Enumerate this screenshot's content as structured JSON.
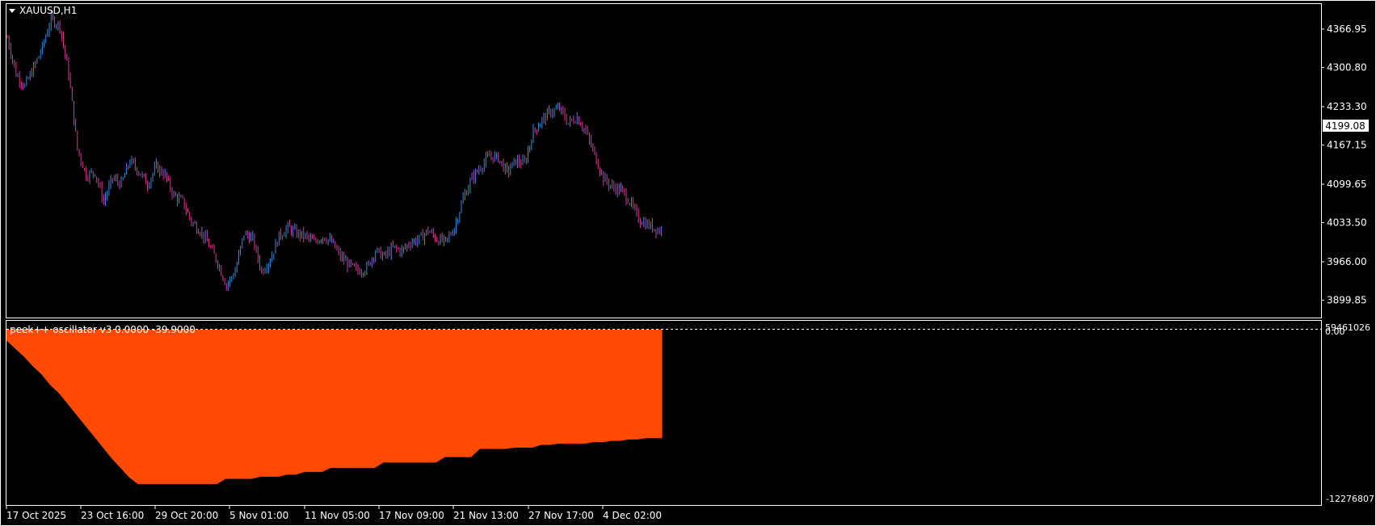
{
  "window": {
    "symbol_label": "XAUUSD,H1",
    "current_price_label": "4199.08"
  },
  "colors": {
    "background": "#000000",
    "grid_border": "#ffffff",
    "candle_bull": "#3e8ad6",
    "candle_bear": "#d23c96",
    "oscillator_fill": "#ff4a06",
    "price_tag_bg": "#ffffff",
    "price_tag_fg": "#000000"
  },
  "indicator": {
    "label": "peek++ oscillator v3 0.0000 -39.9000",
    "scale_top_label": "0.00",
    "scale_overlap_label": "59461026",
    "scale_bottom_label": "-12276807"
  },
  "chart_data": [
    {
      "type": "candlestick",
      "title": "XAUUSD,H1",
      "ylim": [
        3870,
        4410
      ],
      "y_ticks": [
        4366.95,
        4300.8,
        4233.3,
        4167.15,
        4099.65,
        4033.5,
        3966.0,
        3899.85
      ],
      "x_tick_labels": [
        "17 Oct 2025",
        "23 Oct 16:00",
        "29 Oct 20:00",
        "5 Nov 01:00",
        "11 Nov 05:00",
        "17 Nov 09:00",
        "21 Nov 13:00",
        "27 Nov 17:00",
        "4 Dec 02:00"
      ],
      "bar_count": 374,
      "close_path": [
        [
          0,
          4352
        ],
        [
          5,
          4290
        ],
        [
          10,
          4268
        ],
        [
          15,
          4300
        ],
        [
          20,
          4335
        ],
        [
          25,
          4385
        ],
        [
          30,
          4372
        ],
        [
          35,
          4290
        ],
        [
          40,
          4160
        ],
        [
          45,
          4115
        ],
        [
          50,
          4120
        ],
        [
          55,
          4070
        ],
        [
          60,
          4110
        ],
        [
          65,
          4100
        ],
        [
          70,
          4140
        ],
        [
          75,
          4122
        ],
        [
          80,
          4100
        ],
        [
          85,
          4130
        ],
        [
          90,
          4115
        ],
        [
          95,
          4080
        ],
        [
          100,
          4070
        ],
        [
          105,
          4035
        ],
        [
          110,
          4020
        ],
        [
          115,
          3995
        ],
        [
          120,
          3965
        ],
        [
          125,
          3925
        ],
        [
          130,
          3950
        ],
        [
          135,
          4015
        ],
        [
          140,
          4005
        ],
        [
          145,
          3950
        ],
        [
          150,
          3970
        ],
        [
          155,
          4010
        ],
        [
          160,
          4025
        ],
        [
          165,
          4015
        ],
        [
          170,
          4010
        ],
        [
          175,
          4000
        ],
        [
          180,
          4010
        ],
        [
          185,
          4000
        ],
        [
          190,
          3975
        ],
        [
          195,
          3960
        ],
        [
          200,
          3950
        ],
        [
          205,
          3955
        ],
        [
          210,
          3985
        ],
        [
          215,
          3975
        ],
        [
          220,
          3990
        ],
        [
          225,
          3985
        ],
        [
          230,
          4000
        ],
        [
          235,
          4005
        ],
        [
          240,
          4020
        ],
        [
          245,
          4005
        ],
        [
          250,
          4000
        ],
        [
          255,
          4025
        ],
        [
          260,
          4075
        ],
        [
          265,
          4110
        ],
        [
          270,
          4130
        ],
        [
          275,
          4148
        ],
        [
          280,
          4145
        ],
        [
          285,
          4120
        ],
        [
          290,
          4140
        ],
        [
          295,
          4135
        ],
        [
          300,
          4190
        ],
        [
          305,
          4210
        ],
        [
          310,
          4225
        ],
        [
          315,
          4230
        ],
        [
          320,
          4205
        ],
        [
          325,
          4215
        ],
        [
          330,
          4190
        ],
        [
          335,
          4150
        ],
        [
          340,
          4110
        ],
        [
          345,
          4095
        ],
        [
          350,
          4090
        ],
        [
          355,
          4070
        ],
        [
          360,
          4040
        ],
        [
          365,
          4030
        ],
        [
          372,
          4020
        ]
      ]
    },
    {
      "type": "area",
      "title": "peek++ oscillator v3 0.0000 -39.9000",
      "ylim": [
        -12276807,
        0
      ],
      "x_bar_end": 374,
      "lower_envelope": [
        [
          0,
          -800000
        ],
        [
          5,
          -1400000
        ],
        [
          10,
          -2000000
        ],
        [
          15,
          -2700000
        ],
        [
          20,
          -3300000
        ],
        [
          25,
          -4100000
        ],
        [
          30,
          -4700000
        ],
        [
          35,
          -5500000
        ],
        [
          40,
          -6300000
        ],
        [
          45,
          -7100000
        ],
        [
          50,
          -7900000
        ],
        [
          55,
          -8700000
        ],
        [
          60,
          -9500000
        ],
        [
          65,
          -10200000
        ],
        [
          70,
          -10900000
        ],
        [
          75,
          -11400000
        ],
        [
          80,
          -11400000
        ],
        [
          85,
          -11400000
        ],
        [
          90,
          -11400000
        ],
        [
          95,
          -11400000
        ],
        [
          100,
          -11400000
        ],
        [
          105,
          -11400000
        ],
        [
          110,
          -11400000
        ],
        [
          115,
          -11400000
        ],
        [
          120,
          -11400000
        ],
        [
          125,
          -11000000
        ],
        [
          130,
          -11000000
        ],
        [
          135,
          -11000000
        ],
        [
          140,
          -11000000
        ],
        [
          145,
          -10850000
        ],
        [
          150,
          -10850000
        ],
        [
          155,
          -10850000
        ],
        [
          160,
          -10700000
        ],
        [
          165,
          -10700000
        ],
        [
          170,
          -10500000
        ],
        [
          175,
          -10500000
        ],
        [
          180,
          -10500000
        ],
        [
          185,
          -10200000
        ],
        [
          190,
          -10200000
        ],
        [
          195,
          -10200000
        ],
        [
          200,
          -10200000
        ],
        [
          205,
          -10200000
        ],
        [
          210,
          -10200000
        ],
        [
          215,
          -9800000
        ],
        [
          220,
          -9800000
        ],
        [
          225,
          -9800000
        ],
        [
          230,
          -9800000
        ],
        [
          235,
          -9800000
        ],
        [
          240,
          -9800000
        ],
        [
          245,
          -9800000
        ],
        [
          250,
          -9400000
        ],
        [
          255,
          -9400000
        ],
        [
          260,
          -9400000
        ],
        [
          265,
          -9400000
        ],
        [
          270,
          -8800000
        ],
        [
          275,
          -8800000
        ],
        [
          280,
          -8800000
        ],
        [
          285,
          -8800000
        ],
        [
          290,
          -8700000
        ],
        [
          295,
          -8700000
        ],
        [
          300,
          -8700000
        ],
        [
          305,
          -8500000
        ],
        [
          310,
          -8500000
        ],
        [
          315,
          -8400000
        ],
        [
          320,
          -8400000
        ],
        [
          325,
          -8400000
        ],
        [
          330,
          -8400000
        ],
        [
          335,
          -8300000
        ],
        [
          340,
          -8300000
        ],
        [
          345,
          -8200000
        ],
        [
          350,
          -8200000
        ],
        [
          355,
          -8100000
        ],
        [
          360,
          -8100000
        ],
        [
          365,
          -8000000
        ],
        [
          370,
          -8000000
        ],
        [
          374,
          -8000000
        ]
      ]
    }
  ]
}
